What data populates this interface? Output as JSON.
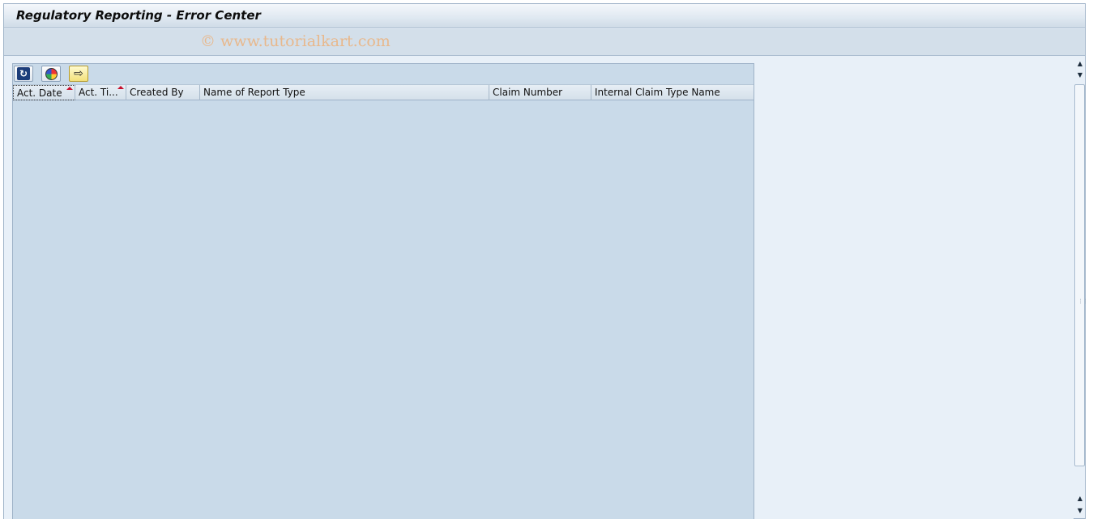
{
  "window": {
    "title": "Regulatory Reporting - Error Center"
  },
  "toolbar": {
    "watermark": "© www.tutorialkart.com"
  },
  "alv": {
    "buttons": [
      {
        "name": "refresh",
        "icon": "refresh-icon"
      },
      {
        "name": "color-legend",
        "icon": "color-wheel-icon"
      },
      {
        "name": "navigate",
        "icon": "right-arrow-icon"
      }
    ],
    "columns": [
      {
        "label": "Act. Date",
        "sorted": "ascending"
      },
      {
        "label": "Act. Ti...",
        "sorted": "ascending"
      },
      {
        "label": "Created By"
      },
      {
        "label": "Name of Report Type"
      },
      {
        "label": "Claim Number"
      },
      {
        "label": "Internal Claim Type Name"
      }
    ],
    "rows": []
  },
  "colors": {
    "grid_bg": "#c9dae9",
    "sort_marker": "#c8102e",
    "watermark": "#e8b88c"
  }
}
